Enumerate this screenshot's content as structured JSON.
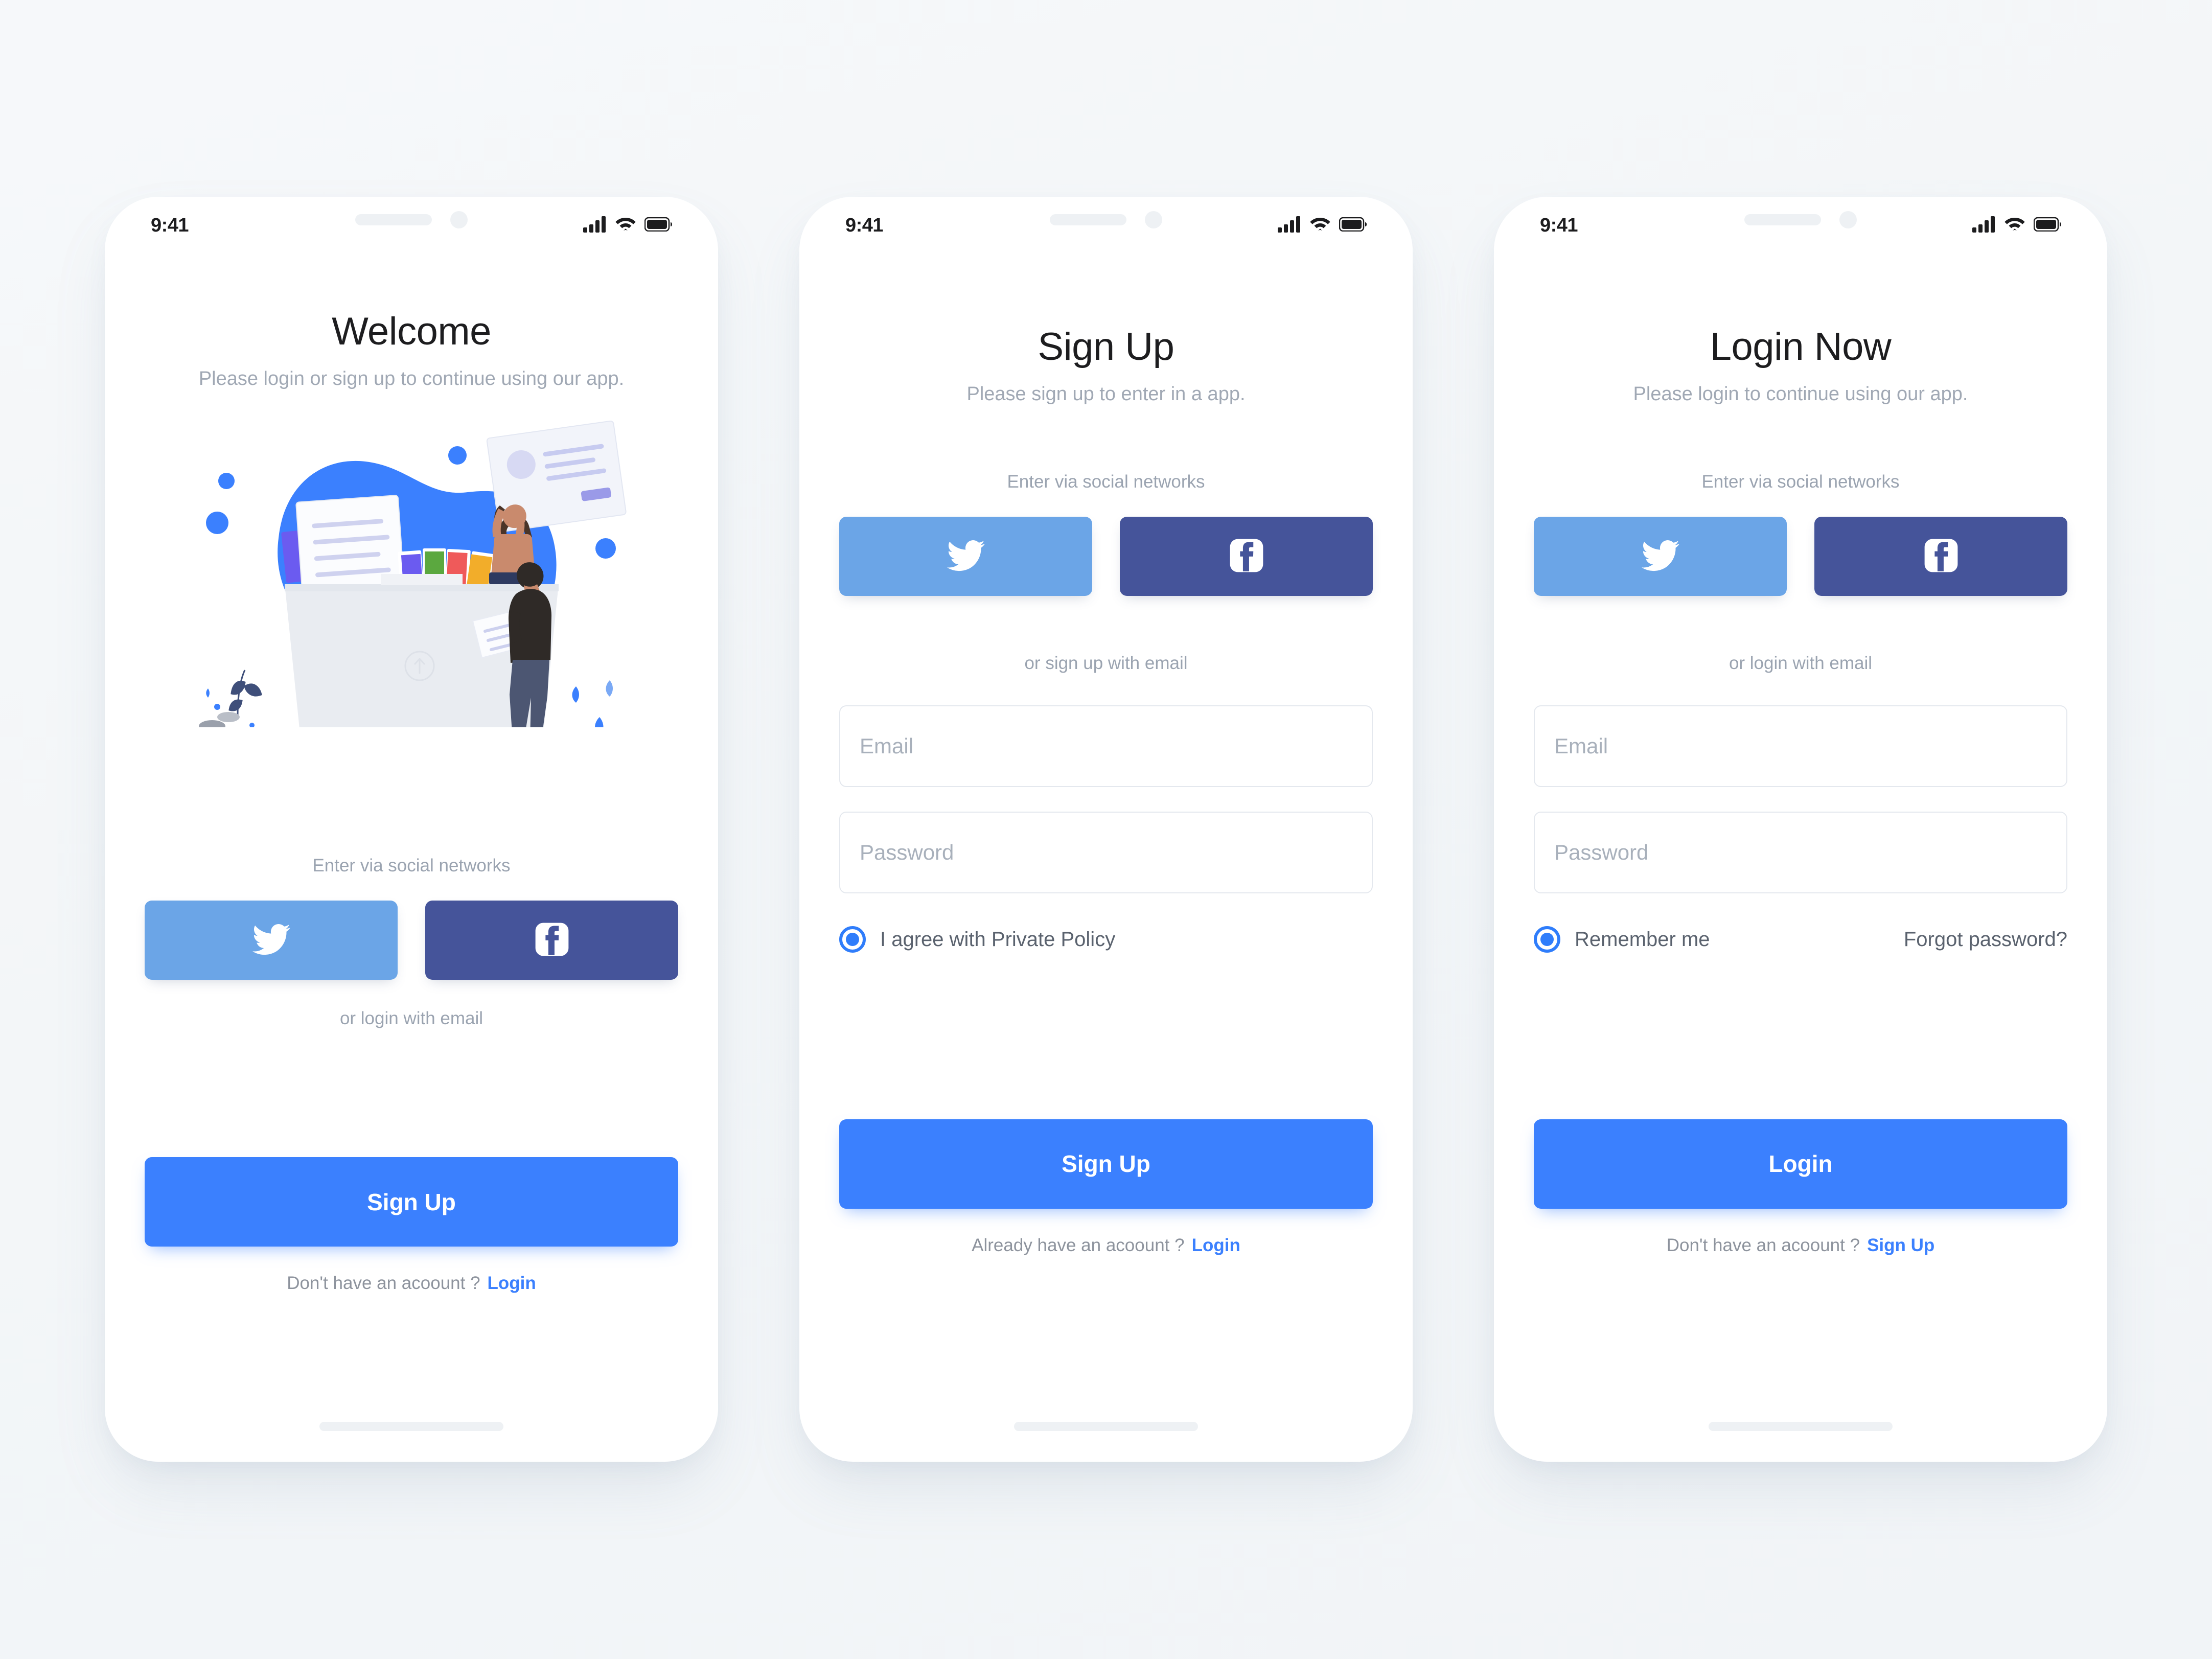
{
  "theme": {
    "background": "#f5f7f9",
    "primary_blue": "#3b80fe",
    "twitter_blue": "#6ba5e7",
    "facebook_blue": "#45549a",
    "muted_text": "#9aa3b0",
    "title_text": "#1d1d1f"
  },
  "status_bar": {
    "time": "9:41",
    "icons": [
      "cellular-signal-icon",
      "wifi-icon",
      "battery-icon"
    ]
  },
  "screens": [
    {
      "id": "welcome",
      "title": "Welcome",
      "subtitle": "Please login or sign up to continue using our app.",
      "illustration": "upload-documents-illustration",
      "social_label": "Enter via social networks",
      "social_buttons": [
        {
          "name": "twitter",
          "icon": "twitter-bird-icon"
        },
        {
          "name": "facebook",
          "icon": "facebook-f-icon"
        }
      ],
      "email_label": "or login with email",
      "primary_button": "Sign Up",
      "footnote_text": "Don't have an acoount ?",
      "footnote_link": "Login"
    },
    {
      "id": "signup",
      "title": "Sign Up",
      "subtitle": "Please sign up to enter in a app.",
      "social_label": "Enter via social networks",
      "social_buttons": [
        {
          "name": "twitter",
          "icon": "twitter-bird-icon"
        },
        {
          "name": "facebook",
          "icon": "facebook-f-icon"
        }
      ],
      "email_label": "or sign up with email",
      "fields": [
        {
          "name": "email",
          "placeholder": "Email",
          "value": ""
        },
        {
          "name": "password",
          "placeholder": "Password",
          "value": ""
        }
      ],
      "option_label": "I agree with Private Policy",
      "option_checked": true,
      "primary_button": "Sign Up",
      "footnote_text": "Already have an acoount ?",
      "footnote_link": "Login"
    },
    {
      "id": "login",
      "title": "Login Now",
      "subtitle": "Please login to continue using our app.",
      "social_label": "Enter via social networks",
      "social_buttons": [
        {
          "name": "twitter",
          "icon": "twitter-bird-icon"
        },
        {
          "name": "facebook",
          "icon": "facebook-f-icon"
        }
      ],
      "email_label": "or login with email",
      "fields": [
        {
          "name": "email",
          "placeholder": "Email",
          "value": ""
        },
        {
          "name": "password",
          "placeholder": "Password",
          "value": ""
        }
      ],
      "option_label": "Remember me",
      "option_checked": true,
      "secondary_link": "Forgot password?",
      "primary_button": "Login",
      "footnote_text": "Don't have an acoount ?",
      "footnote_link": "Sign Up"
    }
  ]
}
